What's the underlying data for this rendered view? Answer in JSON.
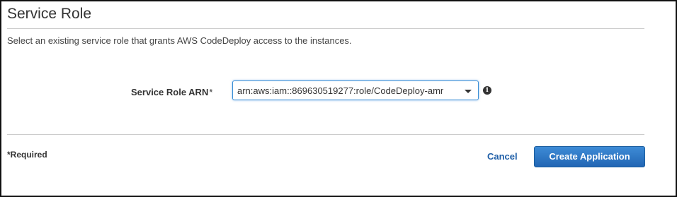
{
  "section": {
    "title": "Service Role",
    "description": "Select an existing service role that grants AWS CodeDeploy access to the instances."
  },
  "form": {
    "service_role_label": "Service Role ARN",
    "required_marker": "*",
    "service_role_value": "arn:aws:iam::869630519277:role/CodeDeploy-amr",
    "info_icon": "info-icon"
  },
  "footer": {
    "required_note": "*Required",
    "cancel_label": "Cancel",
    "create_label": "Create Application"
  },
  "colors": {
    "primary_button": "#2266b4",
    "link": "#1f5fa8",
    "focus_border": "#3b8fd6"
  }
}
